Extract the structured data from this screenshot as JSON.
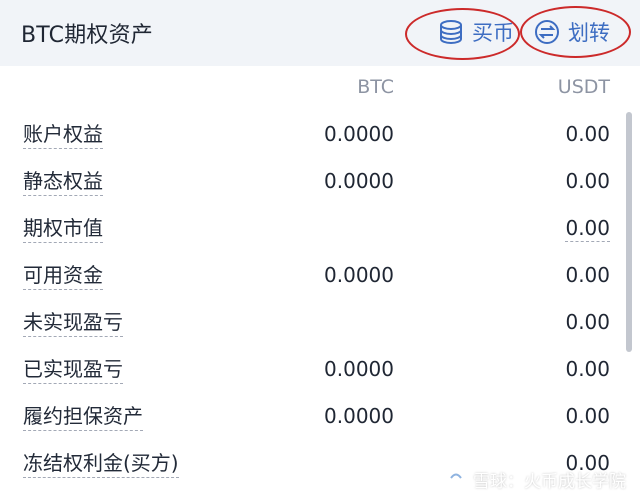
{
  "header": {
    "title": "BTC期权资产",
    "buy_label": "买币",
    "transfer_label": "划转",
    "buy_icon": "coin-stack-icon",
    "transfer_icon": "exchange-arrows-icon",
    "accent_color": "#3d6dc2",
    "annotation_color": "#cc2a2a"
  },
  "columns": {
    "btc": "BTC",
    "usdt": "USDT"
  },
  "rows": [
    {
      "label": "账户权益",
      "btc": "0.0000",
      "usdt": "0.00"
    },
    {
      "label": "静态权益",
      "btc": "0.0000",
      "usdt": "0.00"
    },
    {
      "label": "期权市值",
      "btc": "",
      "usdt": "0.00"
    },
    {
      "label": "可用资金",
      "btc": "0.0000",
      "usdt": "0.00"
    },
    {
      "label": "未实现盈亏",
      "btc": "",
      "usdt": "0.00"
    },
    {
      "label": "已实现盈亏",
      "btc": "0.0000",
      "usdt": "0.00"
    },
    {
      "label": "履约担保资产",
      "btc": "0.0000",
      "usdt": "0.00"
    },
    {
      "label": "冻结权利金(买方)",
      "btc": "",
      "usdt": "0.00"
    }
  ],
  "watermark": {
    "text": "雪球：火币成长学院"
  }
}
